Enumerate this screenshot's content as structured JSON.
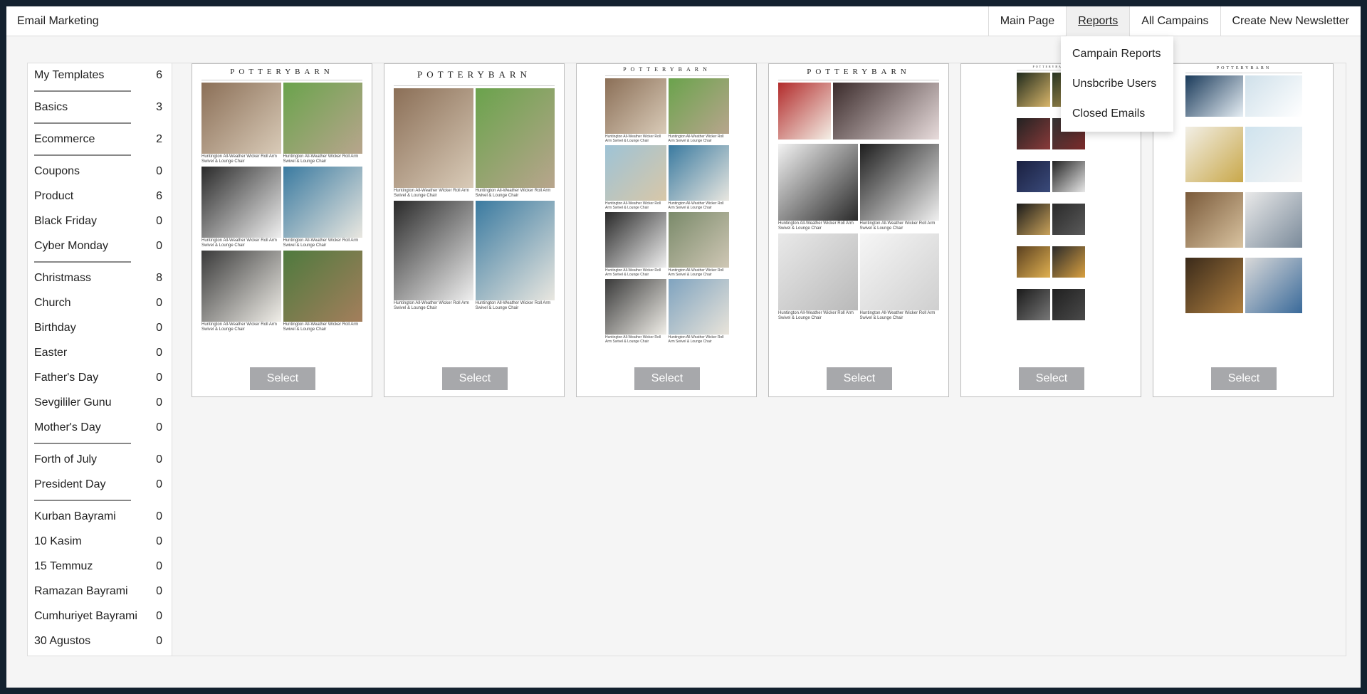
{
  "app": {
    "title": "Email Marketing"
  },
  "nav": {
    "items": [
      {
        "label": "Main Page",
        "active": false
      },
      {
        "label": "Reports",
        "active": true
      },
      {
        "label": "All Campains",
        "active": false
      },
      {
        "label": "Create New Newsletter",
        "active": false
      }
    ]
  },
  "reports_menu": {
    "items": [
      "Campain Reports",
      "Unsbcribe Users",
      "Closed Emails"
    ]
  },
  "sidebar": {
    "categories": [
      {
        "name": "My Templates",
        "count": "6"
      },
      {
        "name": "Basics",
        "count": "3"
      },
      {
        "name": "Ecommerce",
        "count": "2"
      },
      {
        "name": "Coupons",
        "count": "0"
      },
      {
        "name": "Product",
        "count": "6"
      },
      {
        "name": "Black Friday",
        "count": "0"
      },
      {
        "name": "Cyber Monday",
        "count": "0"
      },
      {
        "name": "Christmass",
        "count": "8"
      },
      {
        "name": "Church",
        "count": "0"
      },
      {
        "name": "Birthday",
        "count": "0"
      },
      {
        "name": "Easter",
        "count": "0"
      },
      {
        "name": "Father's Day",
        "count": "0"
      },
      {
        "name": "Sevgililer Gunu",
        "count": "0"
      },
      {
        "name": "Mother's Day",
        "count": "0"
      },
      {
        "name": "Forth of July",
        "count": "0"
      },
      {
        "name": "President Day",
        "count": "0"
      },
      {
        "name": "Kurban Bayrami",
        "count": "0"
      },
      {
        "name": "10 Kasim",
        "count": "0"
      },
      {
        "name": "15 Temmuz",
        "count": "0"
      },
      {
        "name": "Ramazan Bayrami",
        "count": "0"
      },
      {
        "name": "Cumhuriyet Bayrami",
        "count": "0"
      },
      {
        "name": "30 Agustos",
        "count": "0"
      }
    ]
  },
  "templates": {
    "select_label": "Select",
    "cards": [
      {
        "logo": "POTTERYBARN",
        "caption": "Huntington All-Weather Wicker Roll Arm Swivel & Lounge Chair"
      },
      {
        "logo": "POTTERYBARN",
        "caption": "Huntington All-Weather Wicker Roll Arm Swivel & Lounge Chair"
      },
      {
        "logo": "POTTERYBARN",
        "caption": "Huntington All-Weather Wicker Roll Arm Swivel & Lounge Chair"
      },
      {
        "logo": "POTTERYBARN",
        "caption": "Huntington All-Weather Wicker Roll Arm Swivel & Lounge Chair"
      },
      {
        "logo": "POTTERYBARN",
        "caption": ""
      },
      {
        "logo": "POTTERYBARN",
        "caption": ""
      }
    ]
  }
}
